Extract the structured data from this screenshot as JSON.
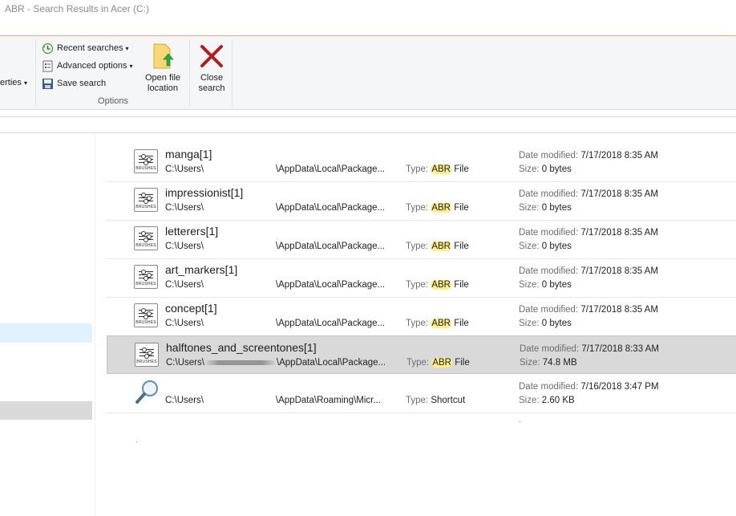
{
  "window": {
    "title": "ABR - Search Results in Acer (C:)"
  },
  "ribbon": {
    "properties_label": "erties",
    "recent_searches": "Recent searches",
    "advanced_options": "Advanced options",
    "save_search": "Save search",
    "open_file_location": "Open file location",
    "close_search": "Close search",
    "group_label": "Options"
  },
  "labels": {
    "type": "Type:",
    "date_modified": "Date modified:",
    "size": "Size:",
    "icon_caption": "BRUSHES"
  },
  "results": [
    {
      "name": "manga[1]",
      "path_start": "C:\\Users\\",
      "path_end": "\\AppData\\Local\\Package...",
      "type_hl": "ABR",
      "type_rest": " File",
      "date": "7/17/2018 8:35 AM",
      "size": "0 bytes",
      "icon": "brushes-file-icon",
      "selected": false
    },
    {
      "name": "impressionist[1]",
      "path_start": "C:\\Users\\",
      "path_end": "\\AppData\\Local\\Package...",
      "type_hl": "ABR",
      "type_rest": " File",
      "date": "7/17/2018 8:35 AM",
      "size": "0 bytes",
      "icon": "brushes-file-icon",
      "selected": false
    },
    {
      "name": "letterers[1]",
      "path_start": "C:\\Users\\",
      "path_end": "\\AppData\\Local\\Package...",
      "type_hl": "ABR",
      "type_rest": " File",
      "date": "7/17/2018 8:35 AM",
      "size": "0 bytes",
      "icon": "brushes-file-icon",
      "selected": false
    },
    {
      "name": "art_markers[1]",
      "path_start": "C:\\Users\\",
      "path_end": "\\AppData\\Local\\Package...",
      "type_hl": "ABR",
      "type_rest": " File",
      "date": "7/17/2018 8:35 AM",
      "size": "0 bytes",
      "icon": "brushes-file-icon",
      "selected": false
    },
    {
      "name": "concept[1]",
      "path_start": "C:\\Users\\",
      "path_end": "\\AppData\\Local\\Package...",
      "type_hl": "ABR",
      "type_rest": " File",
      "date": "7/17/2018 8:35 AM",
      "size": "0 bytes",
      "icon": "brushes-file-icon",
      "selected": false
    },
    {
      "name": "halftones_and_screentones[1]",
      "path_start": "C:\\Users\\",
      "path_end": "\\AppData\\Local\\Package...",
      "type_hl": "ABR",
      "type_rest": " File",
      "date": "7/17/2018 8:33 AM",
      "size": "74.8 MB",
      "icon": "brushes-file-icon",
      "selected": true
    },
    {
      "name": "",
      "path_start": "C:\\Users\\",
      "path_end": "\\AppData\\Roaming\\Micr...",
      "type_hl": "",
      "type_rest": "Shortcut",
      "date": "7/16/2018 3:47 PM",
      "size": "2.60 KB",
      "icon": "search-shortcut-icon",
      "selected": false
    }
  ],
  "colors": {
    "accent_border": "#e8a977",
    "highlight": "#ffef85",
    "selected_row": "#d9d9d9",
    "close_x": "#b01e23"
  }
}
